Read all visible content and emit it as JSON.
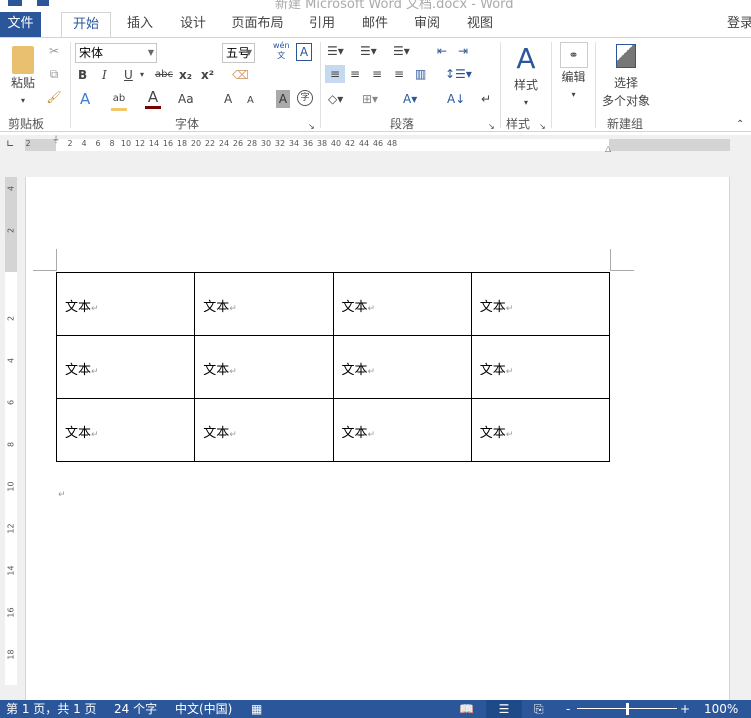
{
  "window": {
    "title": "新建 Microsoft Word 文档.docx - Word",
    "login": "登录"
  },
  "tabs": [
    {
      "label": "文件"
    },
    {
      "label": "开始"
    },
    {
      "label": "插入"
    },
    {
      "label": "设计"
    },
    {
      "label": "页面布局"
    },
    {
      "label": "引用"
    },
    {
      "label": "邮件"
    },
    {
      "label": "审阅"
    },
    {
      "label": "视图"
    }
  ],
  "active_tab": "开始",
  "ribbon": {
    "clipboard": {
      "label": "剪贴板",
      "paste": "粘贴"
    },
    "font": {
      "label": "字体",
      "font_name": "宋体",
      "font_size": "五号",
      "pinyin": "wén",
      "bold": "B",
      "italic": "I",
      "underline": "U",
      "strike": "abc",
      "subscript": "x₂",
      "superscript": "x²",
      "case": "Aa",
      "grow": "A",
      "shrink": "A",
      "shade": "A",
      "enclose": "字",
      "color_font": "#7b0000",
      "color_highlight": "#f3c86d"
    },
    "paragraph": {
      "label": "段落"
    },
    "styles": {
      "label": "样式",
      "button": "样式"
    },
    "editing": {
      "button": "编辑"
    },
    "newgroup": {
      "label": "新建组",
      "button_line1": "选择",
      "button_line2": "多个对象"
    }
  },
  "ruler": {
    "h_labels": [
      "2",
      "2",
      "4",
      "6",
      "8",
      "10",
      "12",
      "14",
      "16",
      "18",
      "20",
      "22",
      "24",
      "26",
      "28",
      "30",
      "32",
      "34",
      "36",
      "38",
      "40",
      "42",
      "44",
      "46",
      "48"
    ],
    "v_labels": [
      "4",
      "2",
      "2",
      "4",
      "6",
      "8",
      "10",
      "12",
      "14",
      "16",
      "18"
    ]
  },
  "document": {
    "table": [
      [
        "文本",
        "文本",
        "文本",
        "文本"
      ],
      [
        "文本",
        "文本",
        "文本",
        "文本"
      ],
      [
        "文本",
        "文本",
        "文本",
        "文本"
      ]
    ],
    "para_mark": "↵"
  },
  "status": {
    "page": "第 1 页，共 1 页",
    "words": "24 个字",
    "language": "中文(中国)",
    "zoom": "100%",
    "zoom_level": 100
  },
  "colors": {
    "accent": "#2b579a"
  }
}
